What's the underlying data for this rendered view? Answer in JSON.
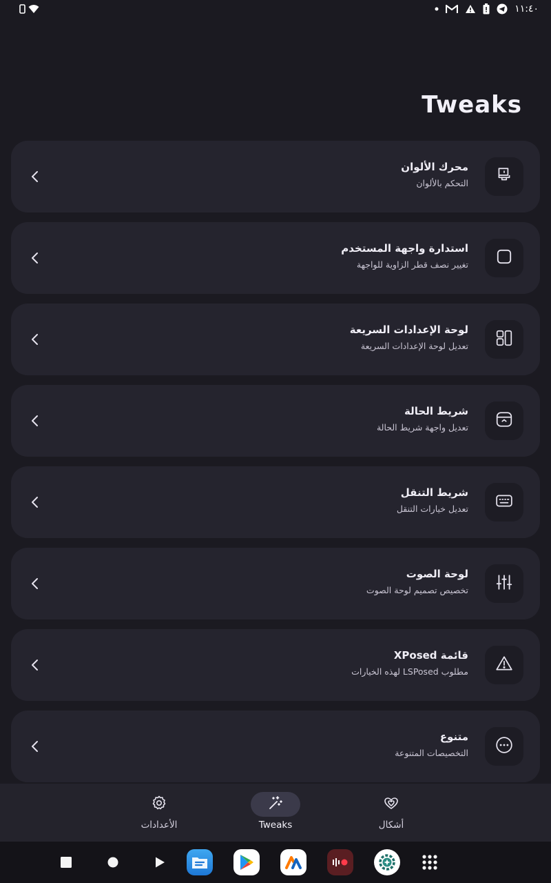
{
  "status_bar": {
    "time": "١١:٤٠",
    "icons": [
      "sim-icon",
      "wifi-icon",
      "dot-icon",
      "gmail-icon",
      "alert-icon",
      "battery-icon",
      "telegram-icon"
    ]
  },
  "page": {
    "title": "Tweaks"
  },
  "items": [
    {
      "title": "محرك الألوان",
      "subtitle": "التحكم بالألوان",
      "icon": "paint-roller-icon"
    },
    {
      "title": "استدارة واجهة المستخدم",
      "subtitle": "تغيير نصف قطر الزاوية للواجهة",
      "icon": "rounded-square-icon"
    },
    {
      "title": "لوحة الإعدادات السريعة",
      "subtitle": "تعديل لوحة الإعدادات السريعة",
      "icon": "tiles-icon"
    },
    {
      "title": "شريط الحالة",
      "subtitle": "تعديل واجهة شريط الحالة",
      "icon": "status-bar-icon"
    },
    {
      "title": "شريط التنقل",
      "subtitle": "تعديل خيارات التنقل",
      "icon": "keyboard-icon"
    },
    {
      "title": "لوحة الصوت",
      "subtitle": "تخصيص تصميم لوحة الصوت",
      "icon": "sliders-icon"
    },
    {
      "title": "قائمة XPosed",
      "subtitle": "مطلوب LSPosed لهذه الخيارات",
      "icon": "warning-icon"
    },
    {
      "title": "متنوع",
      "subtitle": "التخصيصات المتنوعة",
      "icon": "more-icon"
    }
  ],
  "bottom_nav": {
    "settings_label": "الأعدادات",
    "tweaks_label": "Tweaks",
    "themes_label": "أشكال",
    "active": "tweaks"
  },
  "dock": [
    "stop-icon",
    "home-icon",
    "play-icon",
    "es-file-explorer-app",
    "play-store-app",
    "aqua-app",
    "recorder-app",
    "settings-app",
    "app-drawer-icon"
  ],
  "colors": {
    "background": "#1b1a21",
    "card": "#25242e",
    "icon_box": "#1d1c24",
    "nav_bar": "#24232c",
    "nav_active_pill": "#3b3a4a",
    "dock": "#141318"
  }
}
